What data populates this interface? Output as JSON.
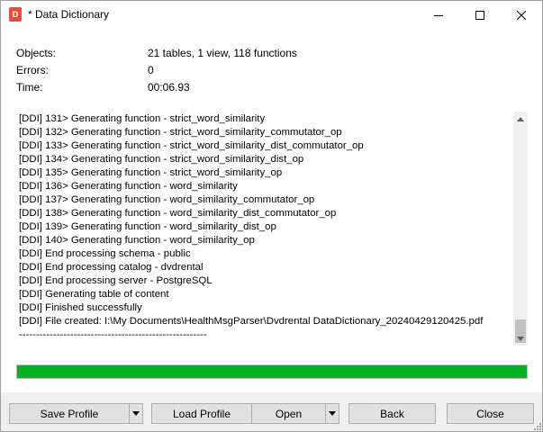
{
  "window": {
    "title": "* Data Dictionary",
    "app_icon_letter": "D"
  },
  "summary": {
    "objects_label": "Objects:",
    "objects_value": "21 tables, 1 view, 118 functions",
    "errors_label": "Errors:",
    "errors_value": "0",
    "time_label": "Time:",
    "time_value": "00:06.93"
  },
  "log": {
    "lines": [
      "[DDI] 131> Generating function - strict_word_similarity",
      "[DDI] 132> Generating function - strict_word_similarity_commutator_op",
      "[DDI] 133> Generating function - strict_word_similarity_dist_commutator_op",
      "[DDI] 134> Generating function - strict_word_similarity_dist_op",
      "[DDI] 135> Generating function - strict_word_similarity_op",
      "[DDI] 136> Generating function - word_similarity",
      "[DDI] 137> Generating function - word_similarity_commutator_op",
      "[DDI] 138> Generating function - word_similarity_dist_commutator_op",
      "[DDI] 139> Generating function - word_similarity_dist_op",
      "[DDI] 140> Generating function - word_similarity_op",
      "[DDI] End processing schema - public",
      "[DDI] End processing catalog - dvdrental",
      "[DDI] End processing server - PostgreSQL",
      "[DDI] Generating table of content",
      "[DDI] Finished successfully",
      "[DDI] File created: I:\\My Documents\\HealthMsgParser\\Dvdrental DataDictionary_20240429120425.pdf",
      "-------------------------------------------------------"
    ]
  },
  "progress": {
    "value_percent": 100,
    "color": "#06b025"
  },
  "buttons": {
    "save_profile": "Save Profile",
    "load_profile": "Load Profile",
    "open": "Open",
    "back": "Back",
    "close": "Close"
  }
}
